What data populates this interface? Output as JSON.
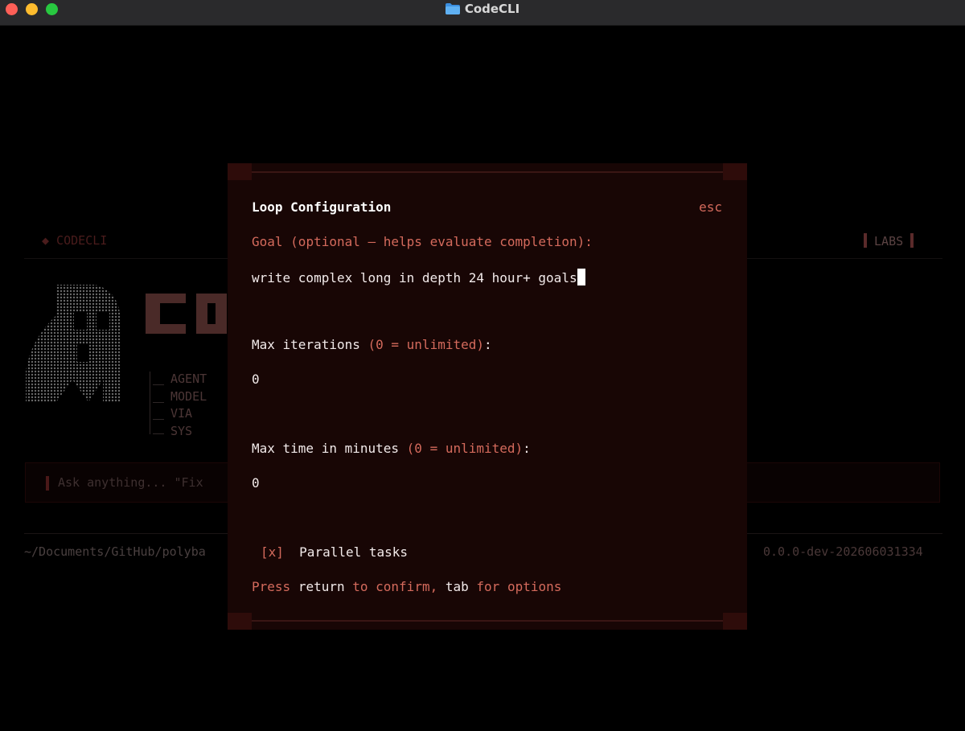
{
  "window": {
    "title": "CodeCLI",
    "folder_icon": "folder-icon"
  },
  "background": {
    "brand": "◆ CODECLI",
    "labs": "LABS",
    "info": {
      "agent": "AGENT",
      "model": "MODEL",
      "via": "VIA",
      "sys": "SYS"
    },
    "input_placeholder": "Ask anything... \"Fix",
    "cwd": "~/Documents/GitHub/polyba",
    "version": "0.0.0-dev-202606031334"
  },
  "modal": {
    "title": "Loop Configuration",
    "esc_label": "esc",
    "goal": {
      "label": "Goal",
      "hint": "(optional — helps evaluate completion):",
      "value": "write complex long in depth 24 hour+ goals"
    },
    "max_iterations": {
      "label": "Max iterations",
      "hint": "(0 = unlimited)",
      "suffix": ":",
      "value": "0"
    },
    "max_time": {
      "label": "Max time in minutes",
      "hint": "(0 = unlimited)",
      "suffix": ":",
      "value": "0"
    },
    "parallel": {
      "checkbox": "[x]",
      "label": "Parallel tasks",
      "checked": true
    },
    "footer": {
      "press": "Press",
      "return_key": "return",
      "to_confirm": "to confirm,",
      "tab_key": "tab",
      "for_options": "for options"
    }
  },
  "colors": {
    "accent": "#d46a5c",
    "modal_bg": "#180605",
    "text": "#f2eaea"
  }
}
